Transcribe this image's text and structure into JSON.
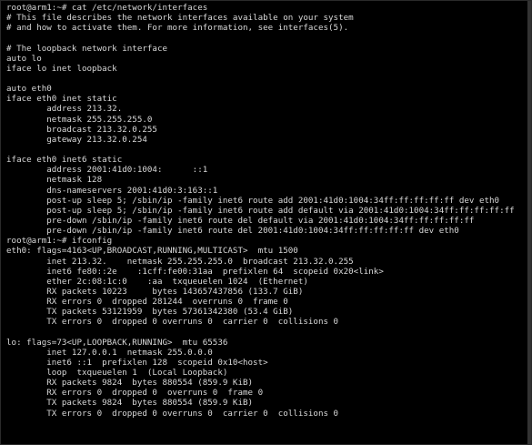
{
  "terminal": {
    "lines": [
      "root@arm1:~# cat /etc/network/interfaces",
      "# This file describes the network interfaces available on your system",
      "# and how to activate them. For more information, see interfaces(5).",
      "",
      "# The loopback network interface",
      "auto lo",
      "iface lo inet loopback",
      "",
      "auto eth0",
      "iface eth0 inet static",
      "        address 213.32.",
      "        netmask 255.255.255.0",
      "        broadcast 213.32.0.255",
      "        gateway 213.32.0.254",
      "",
      "iface eth0 inet6 static",
      "        address 2001:41d0:1004:      ::1",
      "        netmask 128",
      "        dns-nameservers 2001:41d0:3:163::1",
      "        post-up sleep 5; /sbin/ip -family inet6 route add 2001:41d0:1004:34ff:ff:ff:ff:ff dev eth0",
      "        post-up sleep 5; /sbin/ip -family inet6 route add default via 2001:41d0:1004:34ff:ff:ff:ff:ff",
      "        pre-down /sbin/ip -family inet6 route del default via 2001:41d0:1004:34ff:ff:ff:ff:ff",
      "        pre-down /sbin/ip -family inet6 route del 2001:41d0:1004:34ff:ff:ff:ff:ff dev eth0",
      "root@arm1:~# ifconfig",
      "eth0: flags=4163<UP,BROADCAST,RUNNING,MULTICAST>  mtu 1500",
      "        inet 213.32.    netmask 255.255.255.0  broadcast 213.32.0.255",
      "        inet6 fe80::2e    :1cff:fe00:31aa  prefixlen 64  scopeid 0x20<link>",
      "        ether 2c:08:1c:0    :aa  txqueuelen 1024  (Ethernet)",
      "        RX packets 10223     bytes 143657437856 (133.7 GiB)",
      "        RX errors 0  dropped 281244  overruns 0  frame 0",
      "        TX packets 53121959  bytes 57361342380 (53.4 GiB)",
      "        TX errors 0  dropped 0 overruns 0  carrier 0  collisions 0",
      "",
      "lo: flags=73<UP,LOOPBACK,RUNNING>  mtu 65536",
      "        inet 127.0.0.1  netmask 255.0.0.0",
      "        inet6 ::1  prefixlen 128  scopeid 0x10<host>",
      "        loop  txqueuelen 1  (Local Loopback)",
      "        RX packets 9824  bytes 880554 (859.9 KiB)",
      "        RX errors 0  dropped 0  overruns 0  frame 0",
      "        TX packets 9824  bytes 880554 (859.9 KiB)",
      "        TX errors 0  dropped 0 overruns 0  carrier 0  collisions 0",
      "",
      ""
    ]
  },
  "colors": {
    "background": "#000000",
    "text": "#d8d8d8"
  }
}
